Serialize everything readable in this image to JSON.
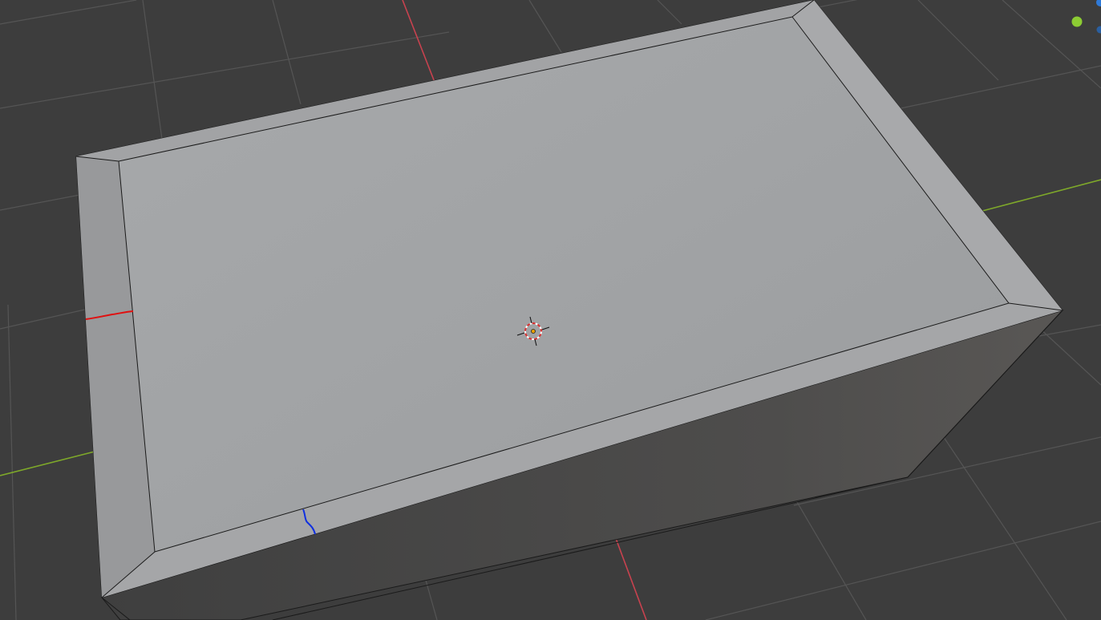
{
  "viewport": {
    "background_color": "#3d3d3d",
    "grid_color": "#545454",
    "x_axis_color": "#c8424f",
    "y_axis_color": "#7ea82a",
    "mesh_top_color": "#a3a5a7",
    "mesh_bevel_color": "#9c9d9f",
    "mesh_side_color": "#525150",
    "mesh_edge_color": "#1a1a1a",
    "annotation_red_color": "#e01010",
    "annotation_blue_color": "#1030e0",
    "gizmo_y_color": "#8ccc33",
    "gizmo_z_color": "#2f7ad8"
  },
  "icons": {
    "cursor": "3d-cursor-icon",
    "gizmo_y": "gizmo-y-axis-icon",
    "gizmo_z": "gizmo-z-axis-icon"
  }
}
